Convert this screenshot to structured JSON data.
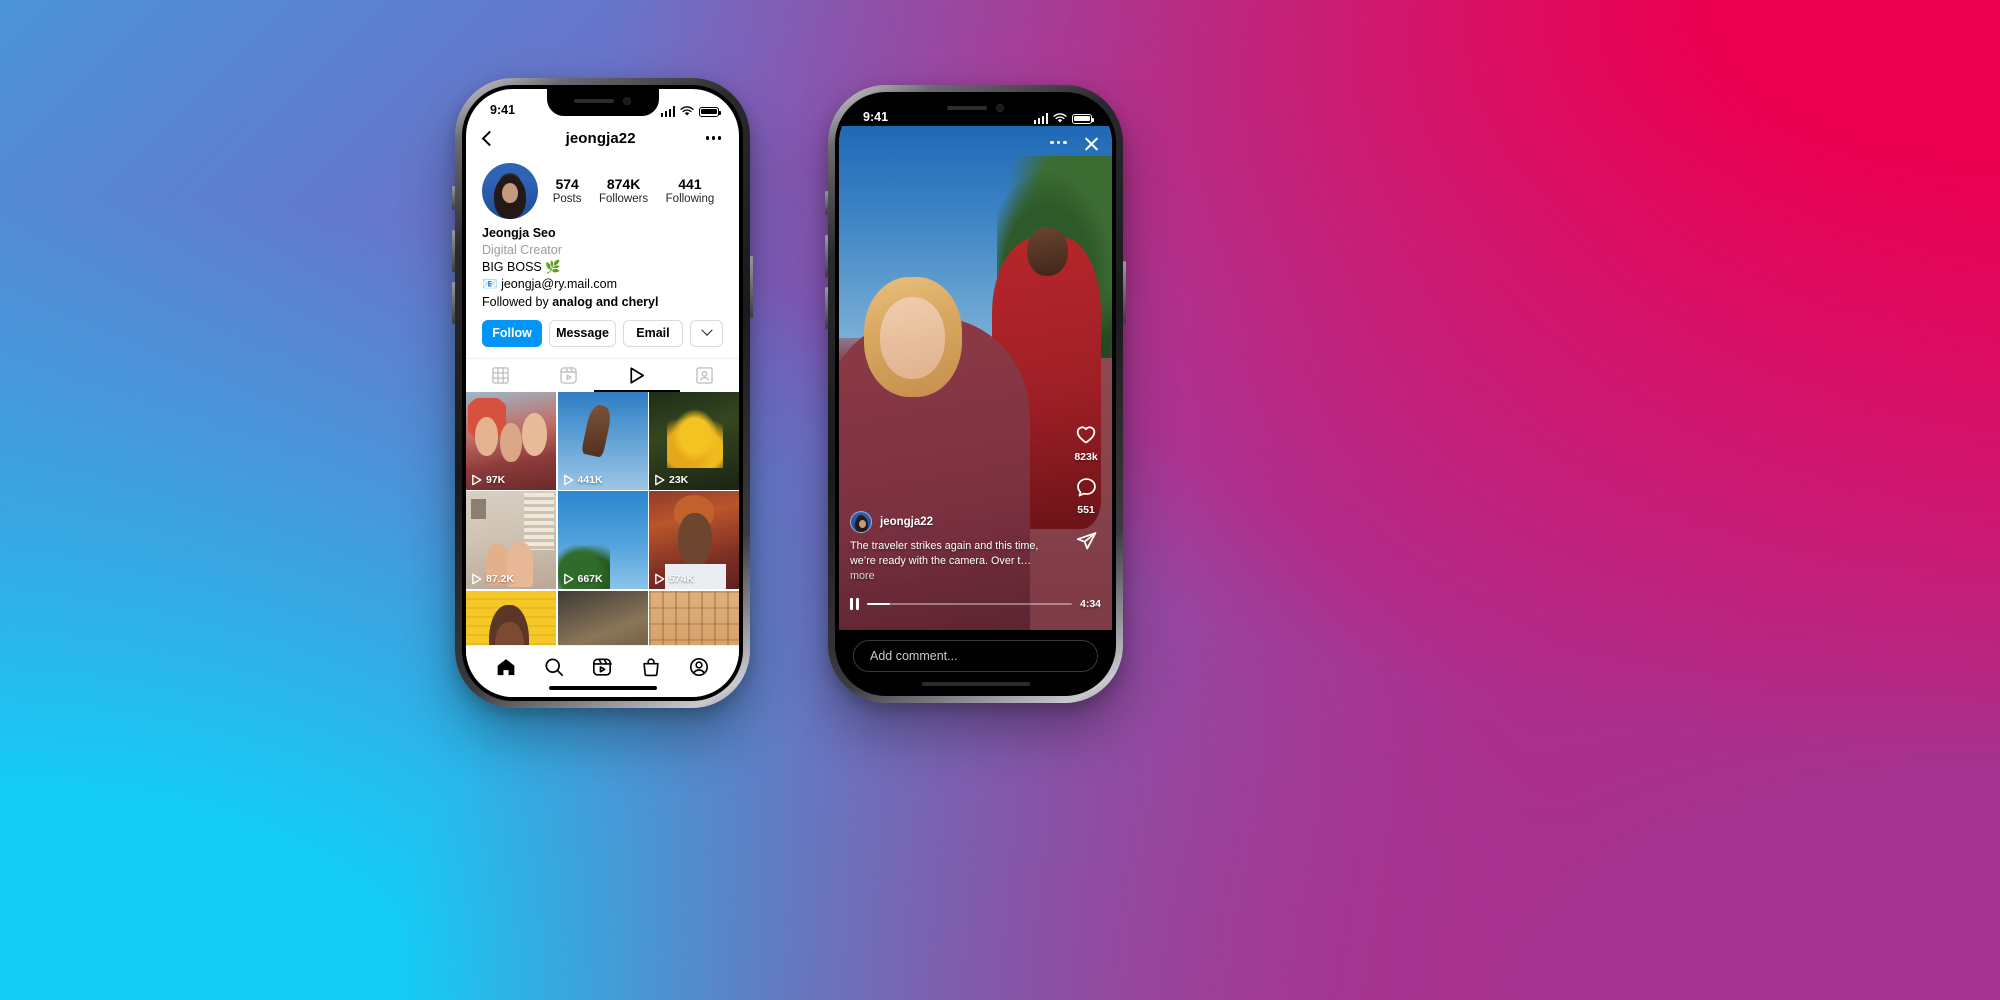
{
  "background": {
    "top_left": "#4b93d8",
    "top_right": "#e6004f",
    "bottom_left": "#14cdf6",
    "bottom_right": "#a6338f"
  },
  "accent": {
    "instagram_blue": "#0095f6",
    "text_primary": "#000000",
    "text_muted": "#9b9b9b"
  },
  "phone_profile": {
    "status_bar": {
      "time": "9:41",
      "cellular_icon": "signal-bars-icon",
      "wifi_icon": "wifi-icon",
      "battery_icon": "battery-icon"
    },
    "nav": {
      "back_icon": "chevron-left-icon",
      "title": "jeongja22",
      "overflow_icon": "more-options-icon"
    },
    "avatar_name": "profile-avatar",
    "stats": [
      {
        "num": "574",
        "label": "Posts"
      },
      {
        "num": "874K",
        "label": "Followers"
      },
      {
        "num": "441",
        "label": "Following"
      }
    ],
    "bio": {
      "display_name": "Jeongja Seo",
      "category": "Digital Creator",
      "line1": "BIG BOSS 🌿",
      "line2_icon": "📧",
      "line2": "jeongja@ry.mail.com",
      "followed_by_prefix": "Followed by ",
      "followed_by_names": "analog and cheryl"
    },
    "actions": {
      "follow": "Follow",
      "message": "Message",
      "email": "Email",
      "more_icon": "chevron-down-icon"
    },
    "tabs": [
      {
        "name": "grid",
        "icon": "grid-icon",
        "active": false
      },
      {
        "name": "reels",
        "icon": "reels-icon",
        "active": false
      },
      {
        "name": "video",
        "icon": "play-triangle-icon",
        "active": true
      },
      {
        "name": "tagged",
        "icon": "tagged-person-icon",
        "active": false
      }
    ],
    "grid": [
      {
        "views": "97K",
        "alt": "three-friends-selfie"
      },
      {
        "views": "441K",
        "alt": "glitter-hand-sky"
      },
      {
        "views": "23K",
        "alt": "yellow-mushrooms"
      },
      {
        "views": "87.2K",
        "alt": "couple-headphones-room"
      },
      {
        "views": "667K",
        "alt": "tree-blue-sky"
      },
      {
        "views": "574K",
        "alt": "woman-gold-curtain"
      },
      {
        "views": "",
        "alt": "woman-yellow-brick-wall"
      },
      {
        "views": "",
        "alt": "mud-texture"
      },
      {
        "views": "",
        "alt": "carved-stone-relief"
      }
    ],
    "tabbar": [
      {
        "name": "home",
        "icon": "home-icon"
      },
      {
        "name": "search",
        "icon": "search-icon"
      },
      {
        "name": "reels",
        "icon": "reels-icon"
      },
      {
        "name": "shop",
        "icon": "shop-bag-icon"
      },
      {
        "name": "profile",
        "icon": "profile-circle-icon"
      }
    ]
  },
  "phone_reel": {
    "status_bar": {
      "time": "9:41",
      "cellular_icon": "signal-bars-icon",
      "wifi_icon": "wifi-icon",
      "battery_icon": "battery-icon"
    },
    "video_overlay": {
      "overflow_icon": "more-options-icon",
      "close_icon": "close-x-icon"
    },
    "rail": {
      "like_icon": "heart-icon",
      "like_count": "823k",
      "comment_icon": "comment-bubble-icon",
      "comment_count": "551",
      "share_icon": "share-paper-plane-icon"
    },
    "caption": {
      "avatar": "reel-author-avatar",
      "username": "jeongja22",
      "text": "The traveler strikes again and this time, we’re ready with the camera. Over t…",
      "more_label": " more"
    },
    "player": {
      "pause_icon": "pause-icon",
      "progress_percent": 11,
      "duration": "4:34"
    },
    "comment_input": {
      "placeholder": "Add comment...",
      "value": ""
    }
  }
}
